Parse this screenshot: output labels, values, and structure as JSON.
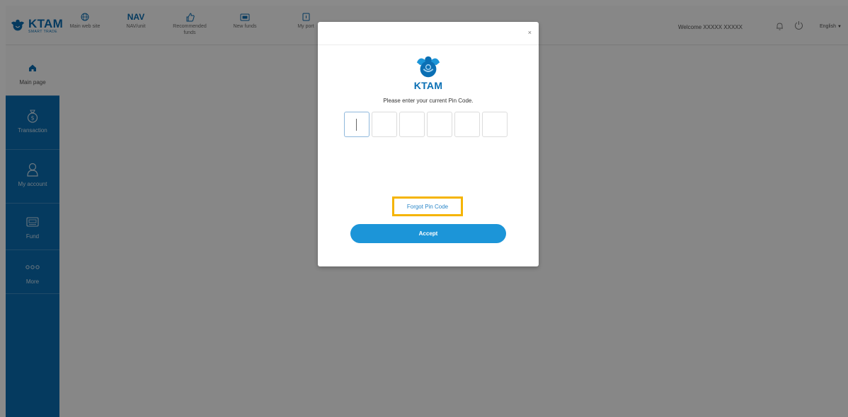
{
  "header": {
    "brand": "KTAM",
    "brand_sub": "SMART TRADE",
    "nav": [
      {
        "label": "Main web site",
        "icon": "globe-icon"
      },
      {
        "label_top": "NAV",
        "label": "NAV/unit",
        "icon": "nav-text"
      },
      {
        "label": "Recommended funds",
        "icon": "thumbs-up-icon"
      },
      {
        "label": "New funds",
        "icon": "new-badge-icon"
      },
      {
        "label": "My port",
        "icon": "portfolio-icon"
      }
    ],
    "welcome": "Welcome XXXXX XXXXX",
    "language": "English"
  },
  "sidebar": {
    "items": [
      {
        "label": "Main page",
        "icon": "home-icon",
        "active": true
      },
      {
        "label": "Transaction",
        "icon": "money-bag-icon"
      },
      {
        "label": "My account",
        "icon": "user-icon"
      },
      {
        "label": "Fund",
        "icon": "fund-card-icon"
      },
      {
        "label": "More",
        "icon": "more-dots-icon"
      }
    ]
  },
  "modal": {
    "close": "×",
    "logo_name": "KTAM",
    "prompt": "Please enter your current Pin Code.",
    "pin_length": 6,
    "forgot": "Forgot Pin Code",
    "accept": "Accept"
  },
  "colors": {
    "primary": "#0a6fb4",
    "accent_button": "#1c95d8",
    "highlight": "#f5b400",
    "overlay": "#000000"
  }
}
